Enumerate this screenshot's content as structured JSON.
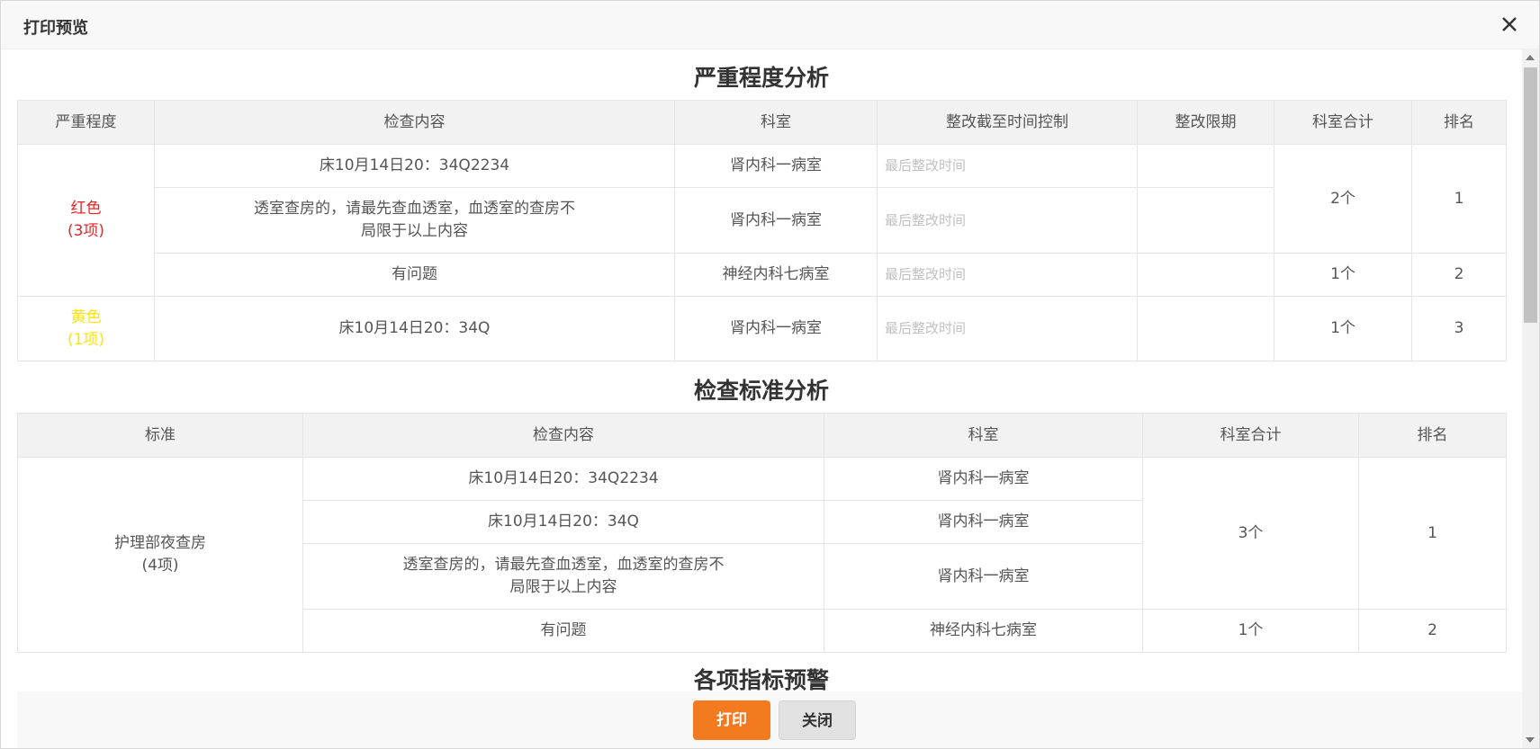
{
  "dialog": {
    "title": "打印预览",
    "close_icon": "close-icon"
  },
  "severity": {
    "title": "严重程度分析",
    "headers": [
      "严重程度",
      "检查内容",
      "科室",
      "整改截至时间控制",
      "整改限期",
      "科室合计",
      "排名"
    ],
    "placeholder": "最后整改时间",
    "groups": [
      {
        "label": "红色",
        "count": "(3项)",
        "color": "#e8262a"
      },
      {
        "label": "黄色",
        "count": "(1项)",
        "color": "#ffe400"
      }
    ],
    "rows": [
      {
        "content": "床10月14日20：34Q2234",
        "dept": "肾内科一病室"
      },
      {
        "content": "透室查房的，请最先查血透室，血透室的查房不局限于以上内容",
        "dept": "肾内科一病室"
      },
      {
        "content": "有问题",
        "dept": "神经内科七病室"
      },
      {
        "content": "床10月14日20：34Q",
        "dept": "肾内科一病室"
      }
    ],
    "totals": [
      "2个",
      "1个",
      "1个"
    ],
    "ranks": [
      "1",
      "2",
      "3"
    ]
  },
  "standard": {
    "title": "检查标准分析",
    "headers": [
      "标准",
      "检查内容",
      "科室",
      "科室合计",
      "排名"
    ],
    "group": {
      "label": "护理部夜查房",
      "count": "(4项)"
    },
    "rows": [
      {
        "content": "床10月14日20：34Q2234",
        "dept": "肾内科一病室"
      },
      {
        "content": "床10月14日20：34Q",
        "dept": "肾内科一病室"
      },
      {
        "content": "透室查房的，请最先查血透室，血透室的查房不局限于以上内容",
        "dept": "肾内科一病室"
      },
      {
        "content": "有问题",
        "dept": "神经内科七病室"
      }
    ],
    "totals": [
      "3个",
      "1个"
    ],
    "ranks": [
      "1",
      "2"
    ]
  },
  "warning": {
    "title": "各项指标预警"
  },
  "footer": {
    "print_label": "打印",
    "close_label": "关闭"
  },
  "colors": {
    "accent": "#f47a20"
  }
}
